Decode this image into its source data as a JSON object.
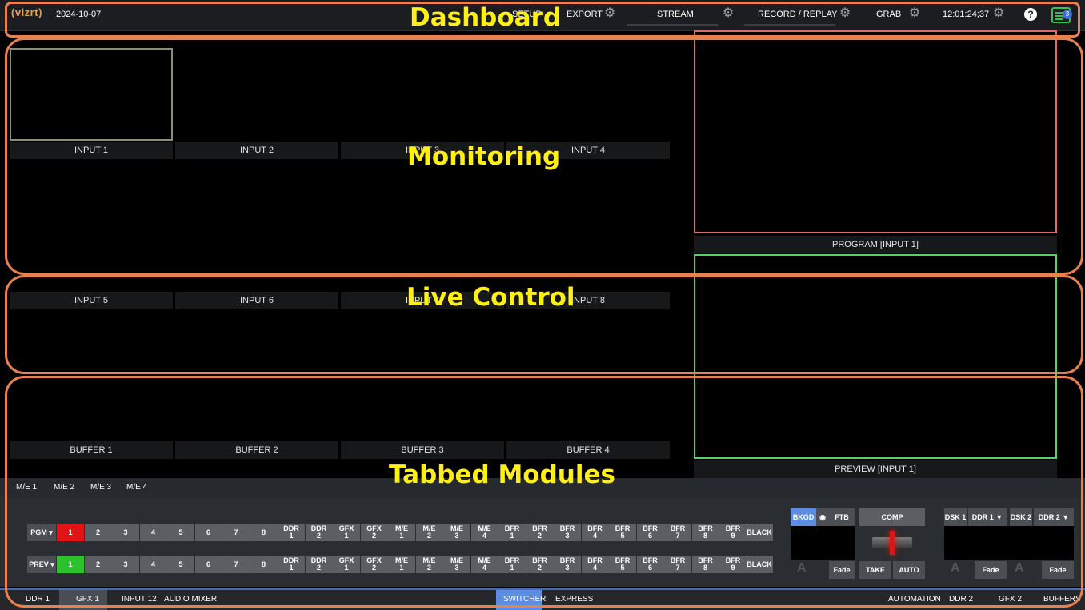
{
  "topbar": {
    "logo": "vizrt",
    "date": "2024-10-07",
    "setup": "SETUP",
    "export": "EXPORT",
    "stream": "STREAM",
    "record_replay": "RECORD / REPLAY",
    "grab": "GRAB",
    "clock": "12:01:24;37",
    "help": "?",
    "notifications_count": "3"
  },
  "monitors": {
    "inputs_row1": [
      "INPUT 1",
      "INPUT 2",
      "INPUT 3",
      "INPUT 4"
    ],
    "inputs_row2": [
      "INPUT 5",
      "INPUT 6",
      "INPUT 7",
      "INPUT 8"
    ],
    "buffers": [
      "BUFFER 1",
      "BUFFER 2",
      "BUFFER 3",
      "BUFFER 4"
    ],
    "program": "PROGRAM [INPUT 1]",
    "preview": "PREVIEW [INPUT 1]"
  },
  "regions": {
    "dashboard": "Dashboard",
    "monitoring": "Monitoring",
    "live_control": "Live Control",
    "tabbed_modules": "Tabbed Modules"
  },
  "switcher": {
    "me_tabs": [
      "M/E 1",
      "M/E 2",
      "M/E 3",
      "M/E 4"
    ],
    "pgm_label": "PGM",
    "prev_label": "PREV",
    "numbers": [
      "1",
      "2",
      "3",
      "4",
      "5",
      "6",
      "7",
      "8"
    ],
    "sources": [
      [
        "DDR",
        "1"
      ],
      [
        "DDR",
        "2"
      ],
      [
        "GFX",
        "1"
      ],
      [
        "GFX",
        "2"
      ],
      [
        "M/E",
        "1"
      ],
      [
        "M/E",
        "2"
      ],
      [
        "M/E",
        "3"
      ],
      [
        "M/E",
        "4"
      ],
      [
        "BFR",
        "1"
      ],
      [
        "BFR",
        "2"
      ],
      [
        "BFR",
        "3"
      ],
      [
        "BFR",
        "4"
      ],
      [
        "BFR",
        "5"
      ],
      [
        "BFR",
        "6"
      ],
      [
        "BFR",
        "7"
      ],
      [
        "BFR",
        "8"
      ],
      [
        "BFR",
        "9"
      ]
    ],
    "black": "BLACK",
    "bkgd": "BKGD",
    "ftb": "FTB",
    "comp": "COMP",
    "take": "TAKE",
    "auto": "AUTO",
    "fade": "Fade",
    "dsk1": "DSK 1",
    "ddr1_sel": "DDR 1",
    "dsk2": "DSK 2",
    "ddr2_sel": "DDR 2",
    "ab": "A"
  },
  "bottom_tabs": {
    "left": [
      "DDR 1",
      "GFX 1",
      "INPUT 12",
      "AUDIO MIXER"
    ],
    "center": [
      "SWITCHER",
      "EXPRESS"
    ],
    "right": [
      "AUTOMATION",
      "DDR 2",
      "GFX 2",
      "BUFFERS"
    ]
  },
  "colors": {
    "accent": "#5c8de0",
    "program_border": "#e06a6a",
    "preview_border": "#5ad06a",
    "region_outline": "#e8814f",
    "region_title": "#ffef14",
    "pgm_active": "#e01414",
    "prev_active": "#2cc22c"
  }
}
